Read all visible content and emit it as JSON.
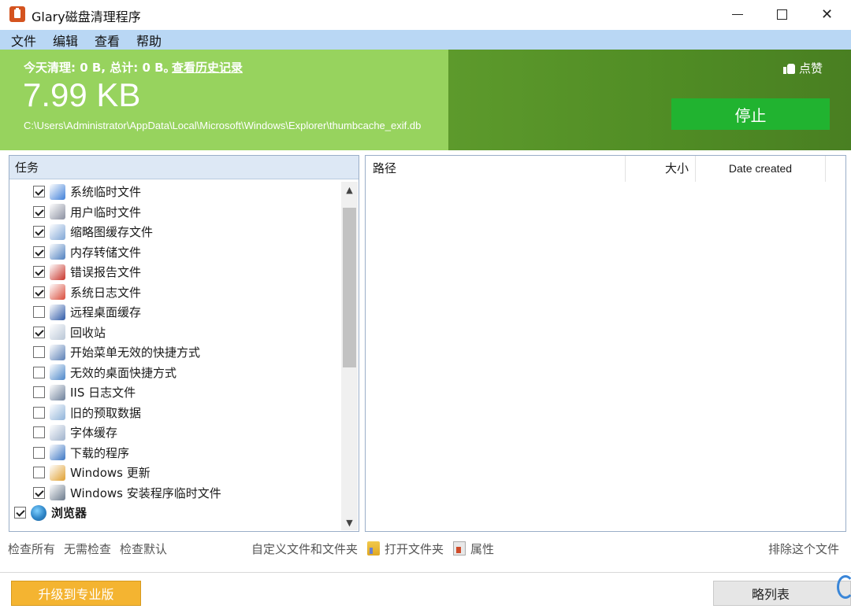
{
  "window": {
    "title": "Glary磁盘清理程序",
    "minimize_label": "—",
    "close_glyph": "✕"
  },
  "menu": [
    "文件",
    "编辑",
    "查看",
    "帮助"
  ],
  "banner": {
    "stats": "今天清理: 0 B, 总计: 0 B。",
    "history_link": "查看历史记录",
    "size": "7.99 KB",
    "path": "C:\\Users\\Administrator\\AppData\\Local\\Microsoft\\Windows\\Explorer\\thumbcache_exif.db",
    "like_label": "点赞",
    "stop_button": "停止"
  },
  "tasks": {
    "header": "任务",
    "items": [
      {
        "label": "系统临时文件",
        "checked": true,
        "icon": "windows-logo-icon",
        "color": "#3f7fd8"
      },
      {
        "label": "用户临时文件",
        "checked": true,
        "icon": "user-file-icon",
        "color": "#8a8fa0"
      },
      {
        "label": "缩略图缓存文件",
        "checked": true,
        "icon": "thumbnail-icon",
        "color": "#7fa6d6"
      },
      {
        "label": "内存转储文件",
        "checked": true,
        "icon": "memory-dump-icon",
        "color": "#4e7fbf"
      },
      {
        "label": "错误报告文件",
        "checked": true,
        "icon": "error-report-icon",
        "color": "#c8342a"
      },
      {
        "label": "系统日志文件",
        "checked": true,
        "icon": "system-log-icon",
        "color": "#d94b3a"
      },
      {
        "label": "远程桌面缓存",
        "checked": false,
        "icon": "remote-desktop-icon",
        "color": "#2e5aa8"
      },
      {
        "label": "回收站",
        "checked": true,
        "icon": "recycle-bin-icon",
        "color": "#b9c6d6"
      },
      {
        "label": "开始菜单无效的快捷方式",
        "checked": false,
        "icon": "start-menu-shortcut-icon",
        "color": "#5a7fb6"
      },
      {
        "label": "无效的桌面快捷方式",
        "checked": false,
        "icon": "desktop-shortcut-icon",
        "color": "#4b86c9"
      },
      {
        "label": "IIS 日志文件",
        "checked": false,
        "icon": "iis-log-icon",
        "color": "#6c7f9a"
      },
      {
        "label": "旧的预取数据",
        "checked": false,
        "icon": "prefetch-icon",
        "color": "#8fb3d9"
      },
      {
        "label": "字体缓存",
        "checked": false,
        "icon": "font-cache-icon",
        "color": "#9fb2cc"
      },
      {
        "label": "下载的程序",
        "checked": false,
        "icon": "downloaded-program-icon",
        "color": "#3c76c4"
      },
      {
        "label": "Windows 更新",
        "checked": false,
        "icon": "windows-update-icon",
        "color": "#e0a030"
      },
      {
        "label": "Windows 安装程序临时文件",
        "checked": true,
        "icon": "installer-temp-icon",
        "color": "#6b7a8c"
      },
      {
        "label": "浏览器",
        "checked": true,
        "icon": "globe-icon",
        "color": "#2f86c8",
        "group": true
      }
    ]
  },
  "list": {
    "columns": [
      "路径",
      "大小",
      "Date created"
    ]
  },
  "actions": {
    "check_all": "检查所有",
    "check_none": "无需检查",
    "check_default": "检查默认",
    "custom_folders": "自定义文件和文件夹",
    "open_folder": "打开文件夹",
    "properties": "属性",
    "exclude_file": "排除这个文件"
  },
  "footer": {
    "upgrade_button": "升级到专业版",
    "ignore_button": "略列表"
  }
}
